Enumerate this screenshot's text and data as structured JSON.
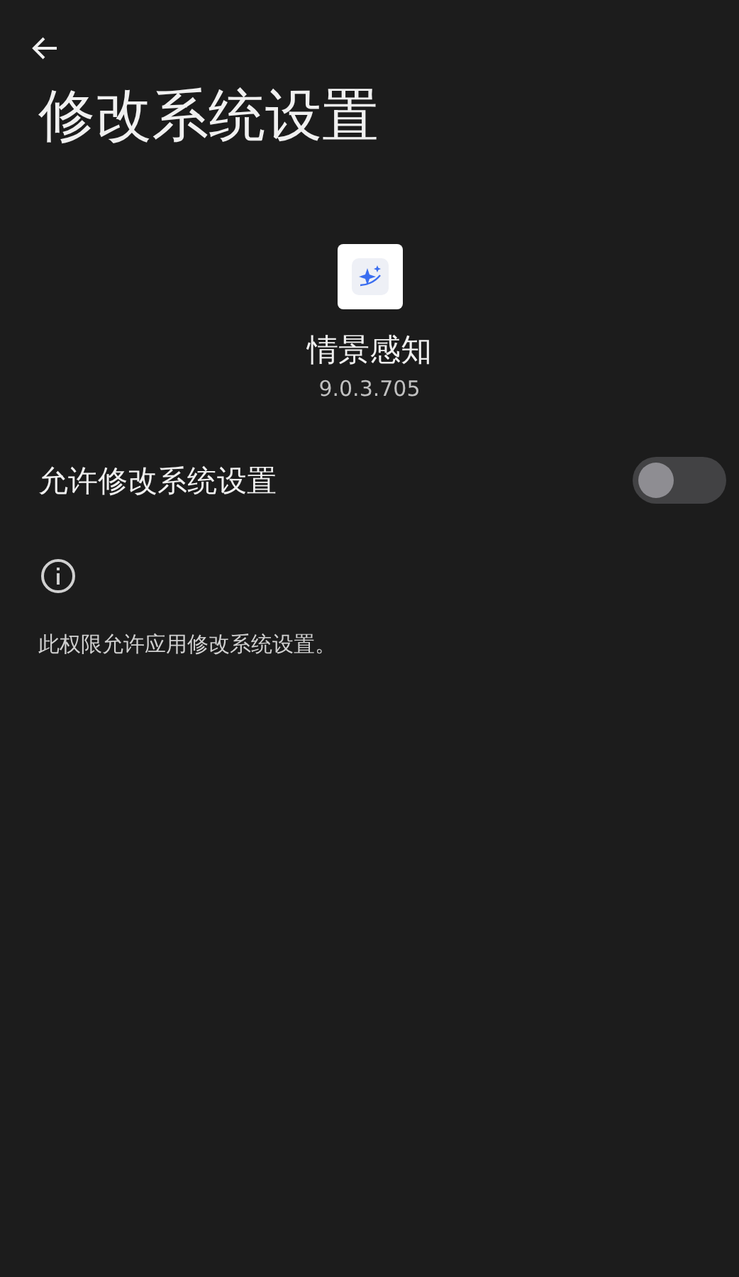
{
  "header": {
    "title": "修改系统设置"
  },
  "app": {
    "name": "情景感知",
    "version": "9.0.3.705"
  },
  "setting": {
    "label": "允许修改系统设置",
    "on": false
  },
  "info": {
    "text": "此权限允许应用修改系统设置。"
  }
}
